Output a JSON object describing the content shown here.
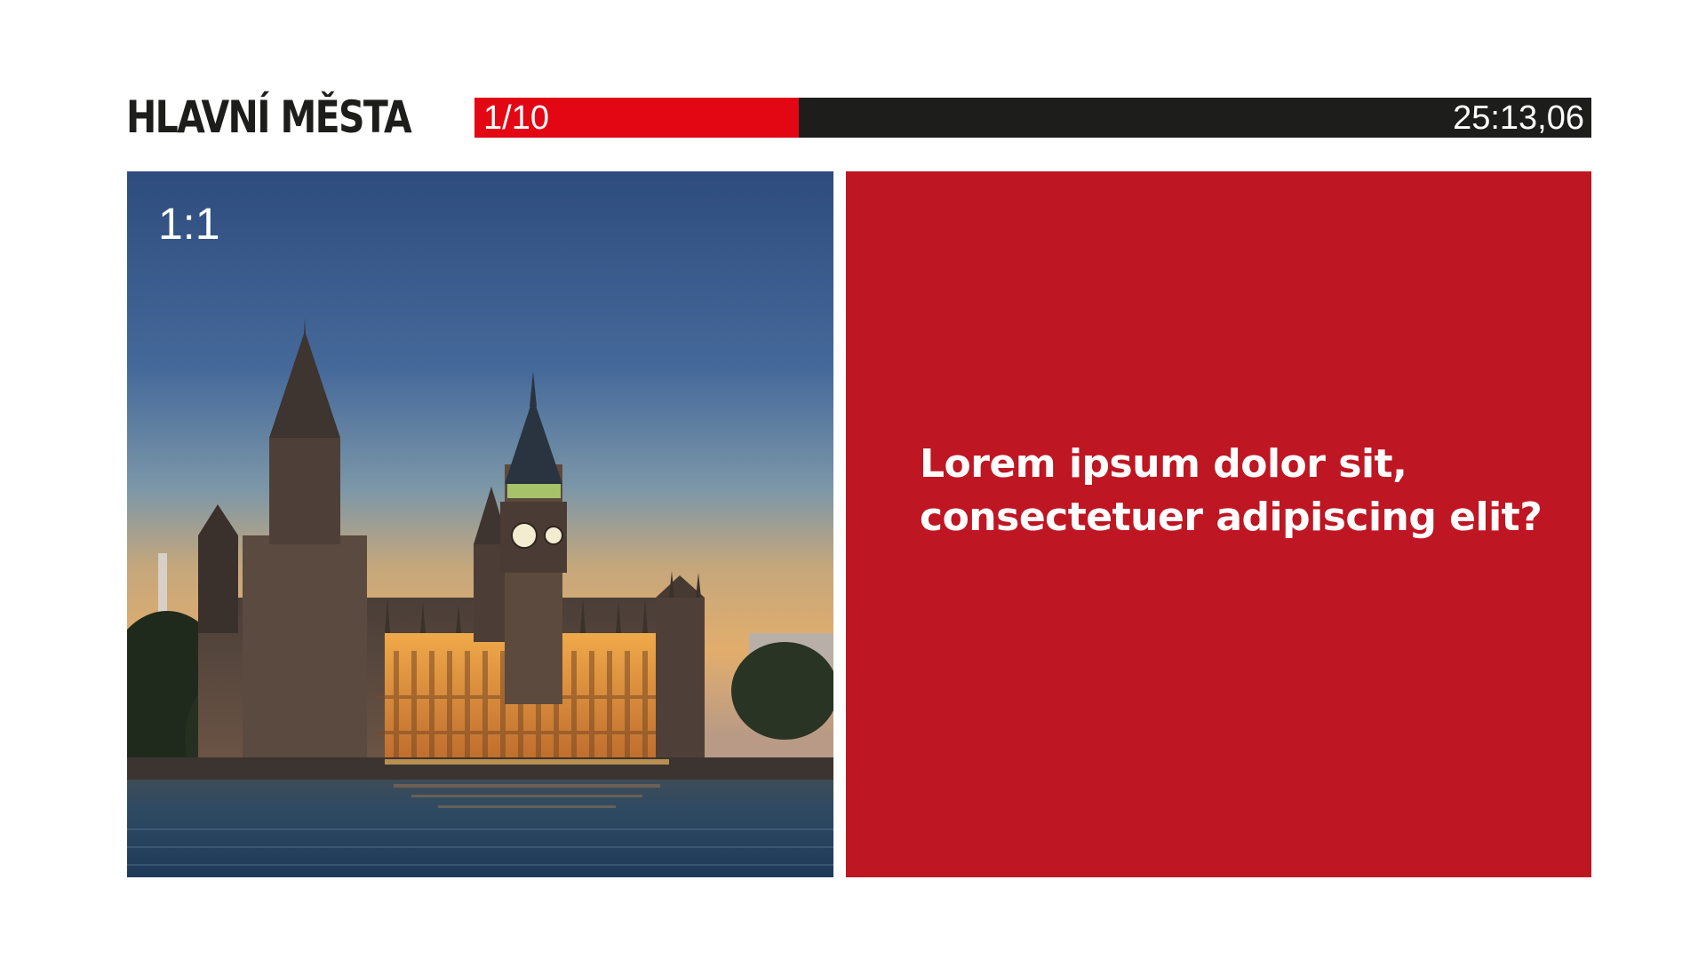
{
  "header": {
    "title": "HLAVNÍ MĚSTA",
    "counter": "1/10",
    "timer": "25:13,06",
    "progress": 0.29
  },
  "image": {
    "ratio_label": "1:1",
    "subject": "Palace of Westminster and Big Ben at dusk across the river"
  },
  "question": {
    "text": "Lorem ipsum dolor sit, consectetuer adipiscing elit?"
  },
  "colors": {
    "accent_red": "#e30613",
    "panel_red": "#be1622",
    "bar_dark": "#1d1d1b"
  }
}
